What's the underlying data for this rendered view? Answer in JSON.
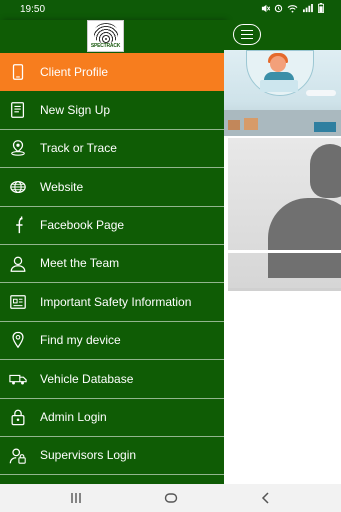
{
  "status_bar": {
    "time": "19:50"
  },
  "drawer": {
    "logo_text": "SPECTRACK",
    "items": [
      {
        "label": "Client Profile",
        "icon": "phone-icon",
        "active": true
      },
      {
        "label": "New Sign Up",
        "icon": "form-icon",
        "active": false
      },
      {
        "label": "Track or Trace",
        "icon": "map-pin-icon",
        "active": false
      },
      {
        "label": "Website",
        "icon": "globe-icon",
        "active": false
      },
      {
        "label": "Facebook Page",
        "icon": "facebook-icon",
        "active": false
      },
      {
        "label": "Meet the Team",
        "icon": "person-icon",
        "active": false
      },
      {
        "label": "Important Safety Information",
        "icon": "document-icon",
        "active": false
      },
      {
        "label": "Find my device",
        "icon": "location-icon",
        "active": false
      },
      {
        "label": "Vehicle Database",
        "icon": "truck-icon",
        "active": false
      },
      {
        "label": "Admin Login",
        "icon": "lock-icon",
        "active": false
      },
      {
        "label": "Supervisors Login",
        "icon": "user-lock-icon",
        "active": false
      }
    ]
  },
  "colors": {
    "primary_green": "#0f5c05",
    "active_orange": "#f77d1e",
    "text": "#ffffff"
  }
}
